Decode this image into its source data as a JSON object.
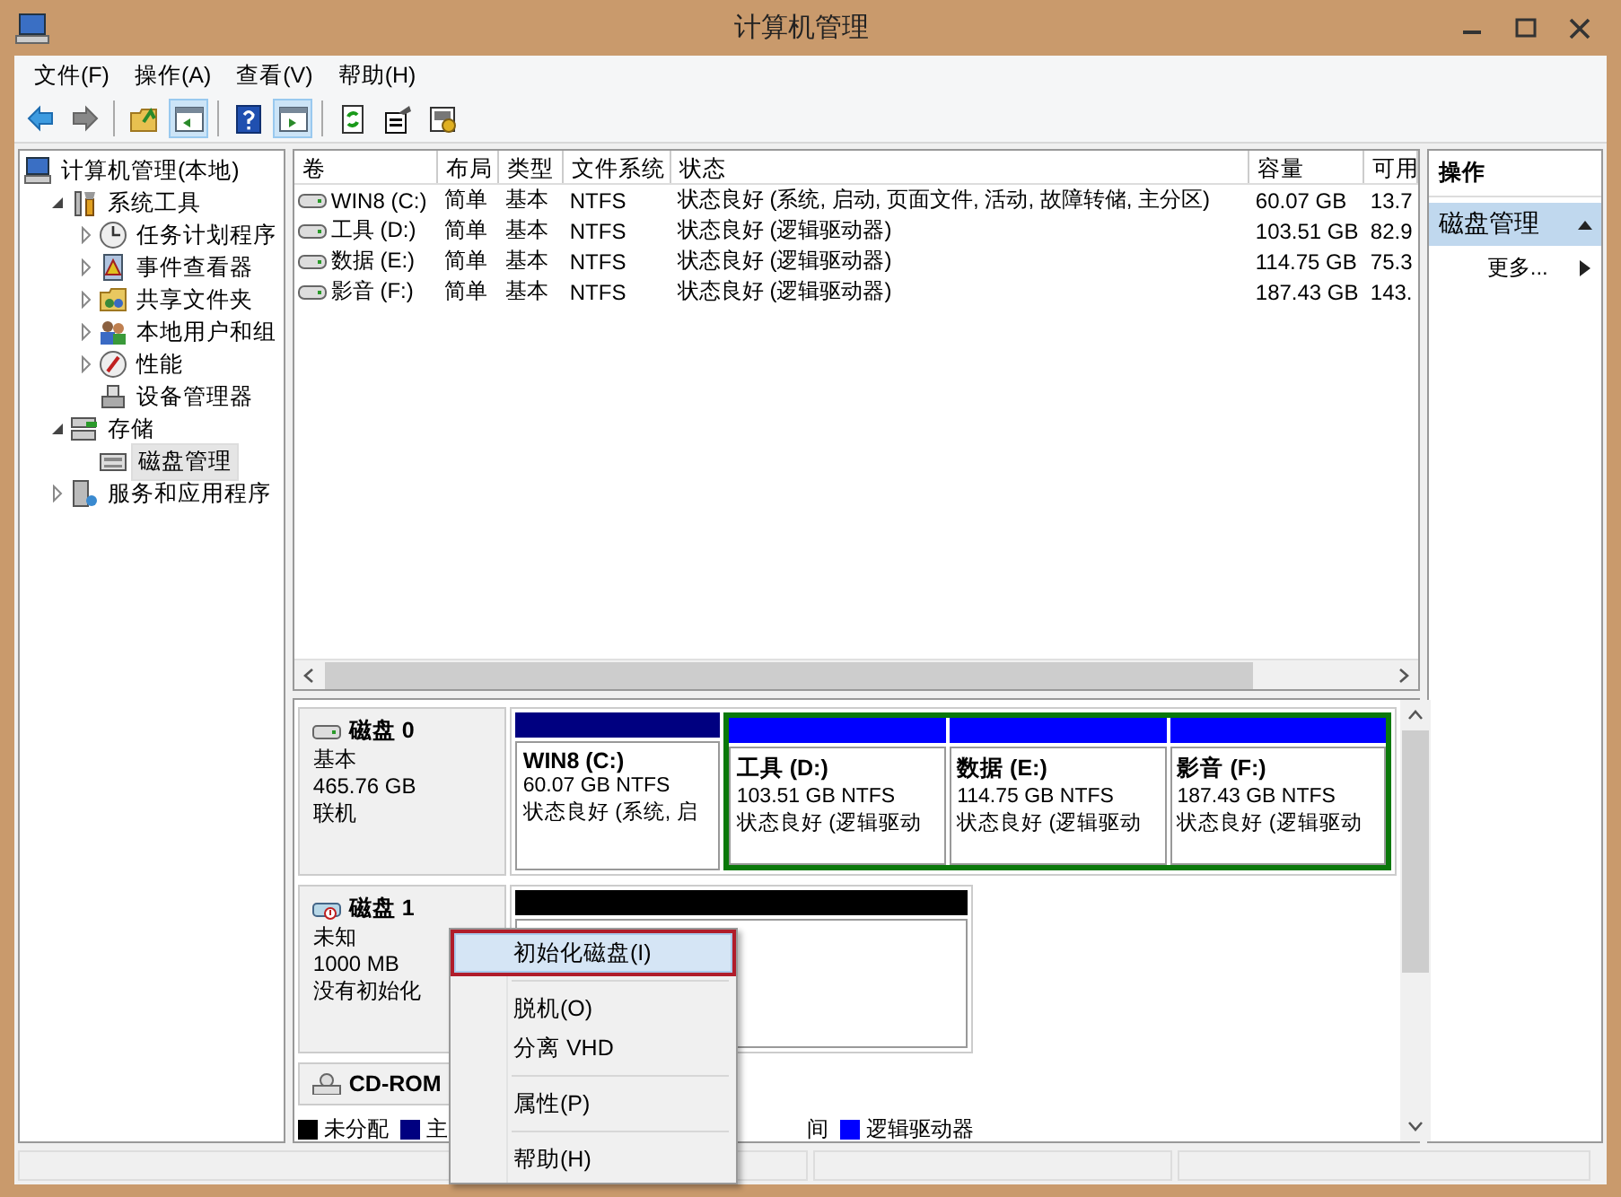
{
  "window": {
    "title": "计算机管理"
  },
  "menu": [
    "文件(F)",
    "操作(A)",
    "查看(V)",
    "帮助(H)"
  ],
  "toolbar": [
    {
      "kind": "back"
    },
    {
      "kind": "forward"
    },
    {
      "kind": "separator"
    },
    {
      "kind": "up"
    },
    {
      "kind": "tree",
      "on": true
    },
    {
      "kind": "separator"
    },
    {
      "kind": "help"
    },
    {
      "kind": "pane",
      "on": true
    },
    {
      "kind": "separator"
    },
    {
      "kind": "refresh"
    },
    {
      "kind": "properties"
    },
    {
      "kind": "settings"
    }
  ],
  "tree": [
    {
      "label": "计算机管理(本地)",
      "selected": false,
      "children": [
        {
          "label": "系统工具",
          "expanded": true,
          "selected": false,
          "children": [
            {
              "label": "任务计划程序",
              "expanded": false,
              "selected": false
            },
            {
              "label": "事件查看器",
              "expanded": false,
              "selected": false
            },
            {
              "label": "共享文件夹",
              "expanded": false,
              "selected": false
            },
            {
              "label": "本地用户和组",
              "expanded": false,
              "selected": false
            },
            {
              "label": "性能",
              "expanded": false,
              "selected": false
            },
            {
              "label": "设备管理器",
              "selected": false
            }
          ]
        },
        {
          "label": "存储",
          "expanded": true,
          "selected": false,
          "children": [
            {
              "label": "磁盘管理",
              "selected": true
            }
          ]
        },
        {
          "label": "服务和应用程序",
          "expanded": false,
          "selected": false
        }
      ]
    }
  ],
  "volumes": {
    "columns": [
      "卷",
      "布局",
      "类型",
      "文件系统",
      "状态",
      "容量",
      "可用"
    ],
    "rows": [
      [
        "WIN8 (C:)",
        "简单",
        "基本",
        "NTFS",
        "状态良好 (系统, 启动, 页面文件, 活动, 故障转储, 主分区)",
        "60.07 GB",
        "13.7"
      ],
      [
        "工具 (D:)",
        "简单",
        "基本",
        "NTFS",
        "状态良好 (逻辑驱动器)",
        "103.51 GB",
        "82.9"
      ],
      [
        "数据 (E:)",
        "简单",
        "基本",
        "NTFS",
        "状态良好 (逻辑驱动器)",
        "114.75 GB",
        "75.3"
      ],
      [
        "影音 (F:)",
        "简单",
        "基本",
        "NTFS",
        "状态良好 (逻辑驱动器)",
        "187.43 GB",
        "143."
      ]
    ]
  },
  "disks": [
    {
      "kind": "basic",
      "name": "磁盘 0",
      "lines": [
        "基本",
        "465.76 GB",
        "联机"
      ],
      "partitions": [
        {
          "kind": "primary",
          "name": "WIN8  (C:)",
          "lines": [
            "60.07 GB NTFS",
            "状态良好 (系统, 启"
          ]
        },
        {
          "kind": "extended",
          "children": [
            {
              "kind": "logical",
              "name": "工具  (D:)",
              "lines": [
                "103.51 GB NTFS",
                "状态良好 (逻辑驱动"
              ]
            },
            {
              "kind": "logical",
              "name": "数据  (E:)",
              "lines": [
                "114.75 GB NTFS",
                "状态良好 (逻辑驱动"
              ]
            },
            {
              "kind": "logical",
              "name": "影音  (F:)",
              "lines": [
                "187.43 GB NTFS",
                "状态良好 (逻辑驱动"
              ]
            }
          ]
        }
      ]
    },
    {
      "kind": "unknown",
      "name": "磁盘 1",
      "lines": [
        "未知",
        "1000 MB",
        "没有初始化"
      ],
      "partitions": [
        {
          "kind": "unallocated"
        }
      ]
    },
    {
      "kind": "cdrom",
      "name": "CD-ROM"
    }
  ],
  "legend": [
    {
      "label": "未分配",
      "color": "#000000"
    },
    {
      "label": "主",
      "color": "#000080"
    },
    {
      "label": "间"
    },
    {
      "label": "逻辑驱动器",
      "color": "#0000ff"
    }
  ],
  "actions": {
    "title": "操作",
    "sections": [
      {
        "label": "磁盘管理",
        "expanded": true,
        "items": [
          "更多..."
        ]
      }
    ]
  },
  "context_menu": {
    "groups": [
      [
        {
          "label": "初始化磁盘(I)",
          "selected": true
        }
      ],
      [
        {
          "label": "脱机(O)",
          "selected": false
        },
        {
          "label": "分离 VHD",
          "selected": false
        }
      ],
      [
        {
          "label": "属性(P)",
          "selected": false
        }
      ],
      [
        {
          "label": "帮助(H)",
          "selected": false
        }
      ]
    ]
  }
}
